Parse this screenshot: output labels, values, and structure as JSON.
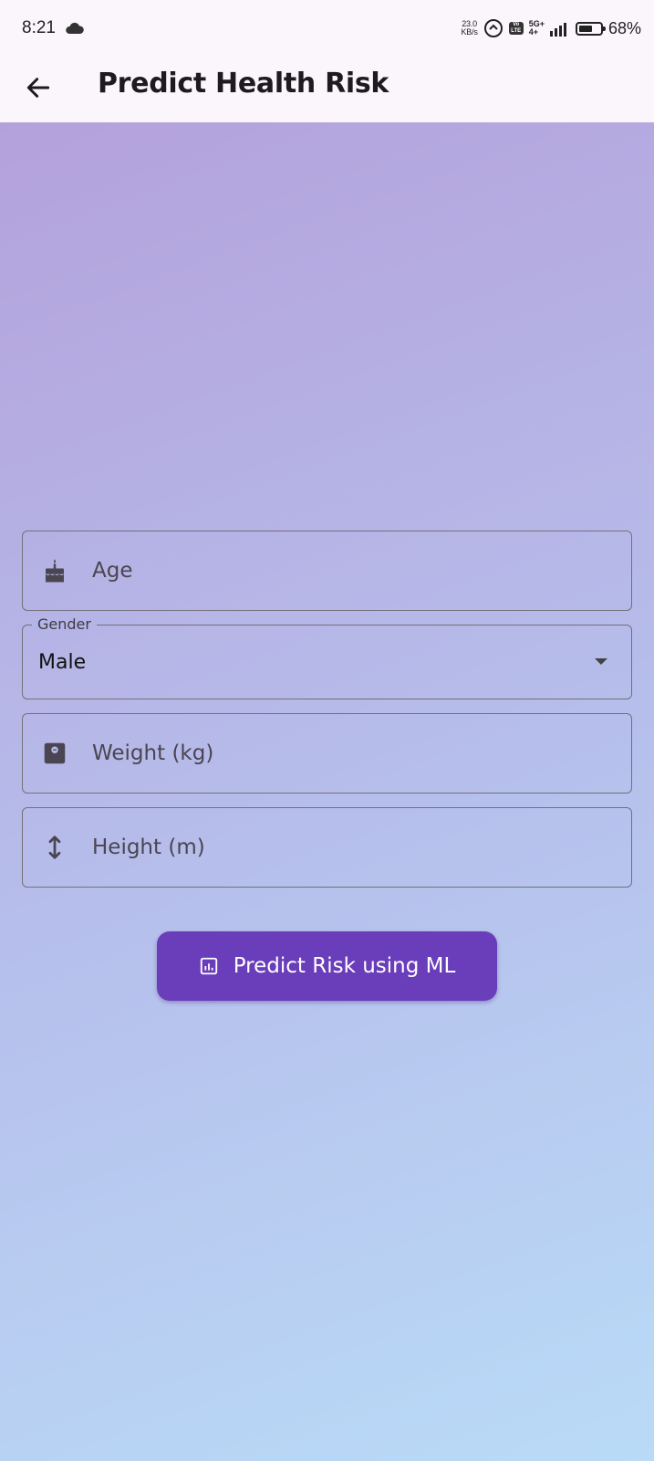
{
  "status_bar": {
    "time": "8:21",
    "net_speed_value": "23.0",
    "net_speed_unit": "KB/s",
    "volte_top": "Vo",
    "volte_bottom": "LTE",
    "network_top": "5G+",
    "network_bottom": "4+",
    "battery_percent": "68%",
    "battery_level": 0.68,
    "icons": [
      "cloud-icon",
      "hotspot-link-icon",
      "volte-icon",
      "signal-icon",
      "battery-icon"
    ]
  },
  "app_bar": {
    "title": "Predict Health Risk",
    "back_icon": "arrow-left"
  },
  "form": {
    "age": {
      "placeholder": "Age",
      "value": "",
      "icon": "cake-icon"
    },
    "gender": {
      "label": "Gender",
      "selected": "Male",
      "icon": "dropdown-arrow"
    },
    "weight": {
      "placeholder": "Weight (kg)",
      "value": "",
      "icon": "scale-icon"
    },
    "height": {
      "placeholder": "Height (m)",
      "value": "",
      "icon": "vertical-arrows-icon"
    }
  },
  "button": {
    "label": "Predict Risk using ML",
    "icon": "analytics-icon"
  },
  "colors": {
    "primary": "#6a3dbb",
    "gradient_start": "#b4a1dc",
    "gradient_end": "#b9dbf7",
    "bar_background": "#fbf6fc"
  }
}
